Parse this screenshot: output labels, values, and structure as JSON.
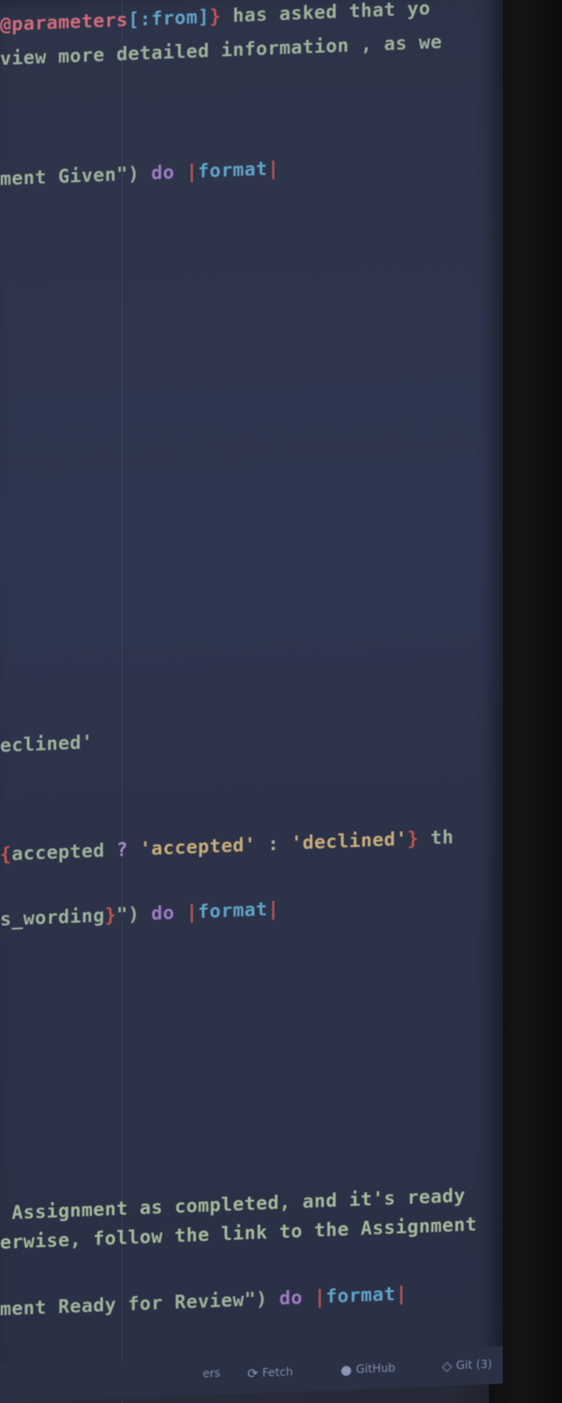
{
  "editor": {
    "lines": [
      {
        "id": "line-1",
        "segments": [
          {
            "t": "@parameters",
            "c": "t-ivar"
          },
          {
            "t": "[:from]",
            "c": "t-sym"
          },
          {
            "t": "} ",
            "c": "t-brace"
          },
          {
            "t": "has asked that yo",
            "c": "t-default"
          }
        ]
      },
      {
        "id": "line-2",
        "segments": [
          {
            "t": "view more detailed information , as we",
            "c": "t-default"
          }
        ]
      },
      {
        "id": "line-3",
        "segments": [
          {
            "t": "ment Given\")",
            "c": "t-default"
          },
          {
            "t": " do ",
            "c": "t-kw"
          },
          {
            "t": "|",
            "c": "t-pipe"
          },
          {
            "t": "format",
            "c": "t-sym"
          },
          {
            "t": "|",
            "c": "t-pipe"
          }
        ]
      },
      {
        "id": "line-4",
        "segments": [
          {
            "t": "eclined'",
            "c": "t-default"
          }
        ]
      },
      {
        "id": "line-5",
        "segments": [
          {
            "t": "{",
            "c": "t-brace"
          },
          {
            "t": "accepted",
            "c": "t-default"
          },
          {
            "t": " ? ",
            "c": "t-op"
          },
          {
            "t": "'accepted'",
            "c": "t-str"
          },
          {
            "t": " : ",
            "c": "t-default"
          },
          {
            "t": "'declined'",
            "c": "t-str"
          },
          {
            "t": "} ",
            "c": "t-brace"
          },
          {
            "t": "th",
            "c": "t-default"
          }
        ]
      },
      {
        "id": "line-6",
        "segments": [
          {
            "t": "s_wording",
            "c": "t-default"
          },
          {
            "t": "}",
            "c": "t-brace"
          },
          {
            "t": "\")",
            "c": "t-default"
          },
          {
            "t": " do ",
            "c": "t-kw"
          },
          {
            "t": "|",
            "c": "t-pipe"
          },
          {
            "t": "format",
            "c": "t-sym"
          },
          {
            "t": "|",
            "c": "t-pipe"
          }
        ]
      },
      {
        "id": "line-7",
        "segments": [
          {
            "t": " Assignment as completed, and it's ready",
            "c": "t-green"
          }
        ]
      },
      {
        "id": "line-8",
        "segments": [
          {
            "t": "erwise, follow the link to the Assignment",
            "c": "t-green"
          }
        ]
      },
      {
        "id": "line-9",
        "segments": [
          {
            "t": "ment Ready for Review\")",
            "c": "t-default"
          },
          {
            "t": " do ",
            "c": "t-kw"
          },
          {
            "t": "|",
            "c": "t-pipe"
          },
          {
            "t": "format",
            "c": "t-sym"
          },
          {
            "t": "|",
            "c": "t-pipe"
          }
        ]
      }
    ]
  },
  "statusbar": {
    "partial_left": "ers",
    "fetch_label": "Fetch",
    "fetch_icon": "sync-icon",
    "github_label": "GitHub",
    "github_icon": "github-icon",
    "git_label": "Git (3)",
    "git_icon": "git-icon"
  }
}
